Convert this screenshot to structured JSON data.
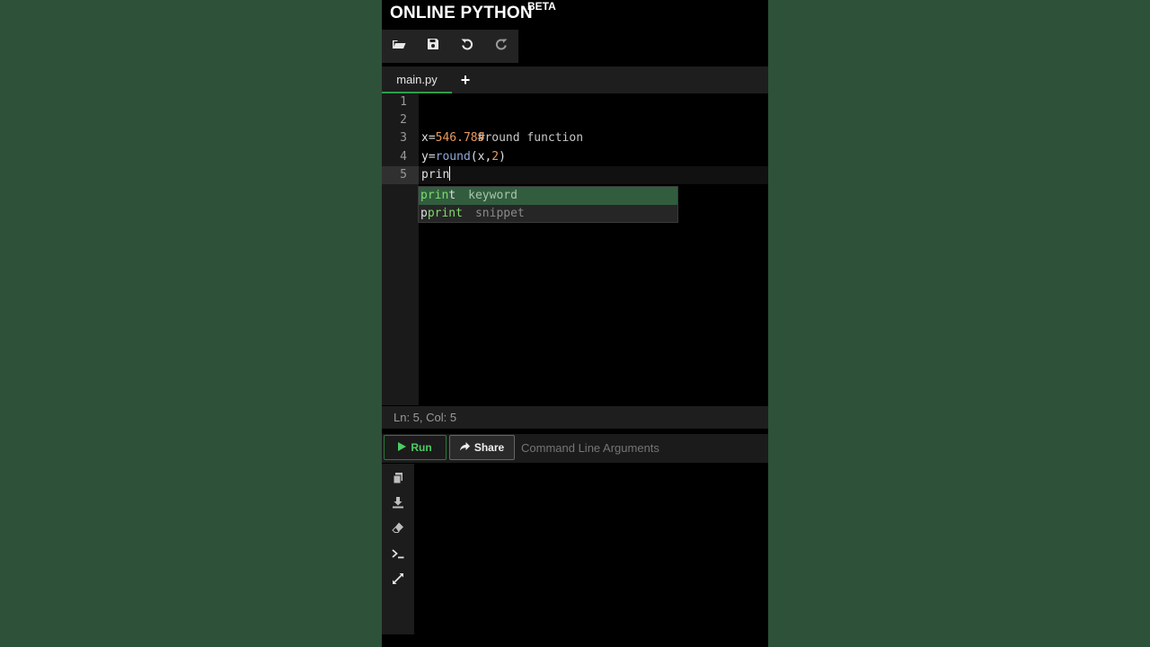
{
  "app": {
    "title": "ONLINE PYTHON",
    "badge": "BETA"
  },
  "toolbar": {
    "icons": [
      "folder-open-icon",
      "save-icon",
      "undo-icon",
      "redo-icon"
    ]
  },
  "tabs": {
    "active": "main.py",
    "add": "+"
  },
  "editor": {
    "line_numbers": [
      "1",
      "2",
      "3",
      "4",
      "5"
    ],
    "lines": {
      "l2": "#round function",
      "l3_var": "x=",
      "l3_num": "546.789",
      "l4_var": "y=",
      "l4_fn": "round",
      "l4_open": "(x,",
      "l4_num": "2",
      "l4_close": ")",
      "l5": "prin"
    }
  },
  "autocomplete": {
    "items": [
      {
        "match": "prin",
        "rest": "t",
        "kind": "keyword"
      },
      {
        "pre": "p",
        "match": "print",
        "kind": "snippet"
      }
    ]
  },
  "status": {
    "position": "Ln: 5,  Col: 5"
  },
  "actions": {
    "run_label": "Run",
    "share_label": "Share",
    "args_placeholder": "Command Line Arguments"
  },
  "console": {
    "icons": [
      "copy-icon",
      "download-icon",
      "eraser-icon",
      "terminal-icon",
      "expand-icon"
    ]
  },
  "colors": {
    "background": "#2d5139",
    "accent": "#2e9e46",
    "run_text": "#4ccd62",
    "autocomplete_selected": "#315d3e"
  }
}
